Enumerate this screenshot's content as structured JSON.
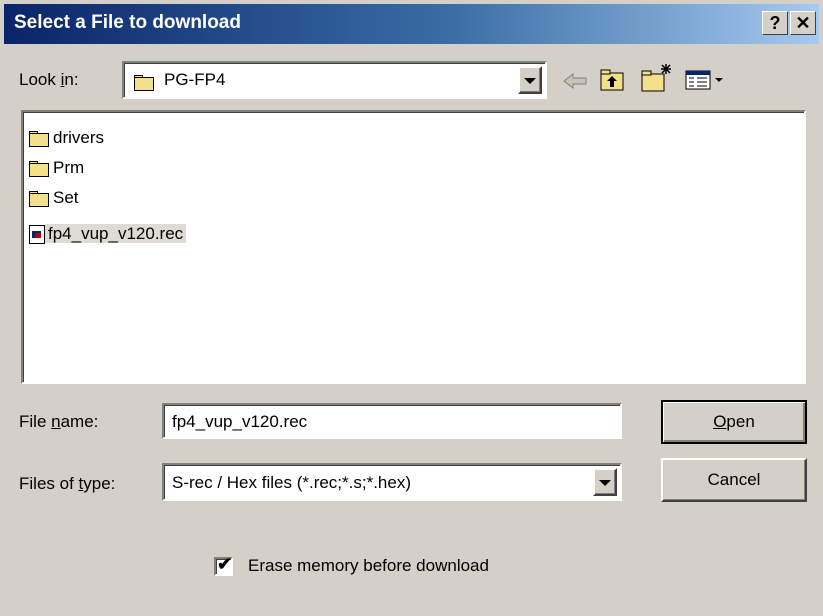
{
  "window": {
    "title": "Select a File to download",
    "help_label": "?",
    "close_label": "✕"
  },
  "toolbar": {
    "look_in_label_pre": "Look ",
    "look_in_label_key": "i",
    "look_in_label_post": "n:",
    "look_in_value": "PG-FP4"
  },
  "files": [
    {
      "name": "drivers",
      "type": "folder"
    },
    {
      "name": "Prm",
      "type": "folder"
    },
    {
      "name": "Set",
      "type": "folder"
    },
    {
      "name": "fp4_vup_v120.rec",
      "type": "file",
      "selected": true
    }
  ],
  "filename": {
    "label_pre": "File ",
    "label_key": "n",
    "label_post": "ame:",
    "value": "fp4_vup_v120.rec"
  },
  "filetype": {
    "label_pre": "Files of ",
    "label_key": "t",
    "label_post": "ype:",
    "value": "S-rec / Hex files (*.rec;*.s;*.hex)"
  },
  "buttons": {
    "open_key": "O",
    "open_rest": "pen",
    "cancel": "Cancel"
  },
  "option": {
    "erase_label": "Erase memory before download",
    "erase_checked": "✔"
  },
  "colors": {
    "title_start": "#0a246a",
    "title_end": "#a6caf0",
    "face": "#d4d0c8"
  }
}
